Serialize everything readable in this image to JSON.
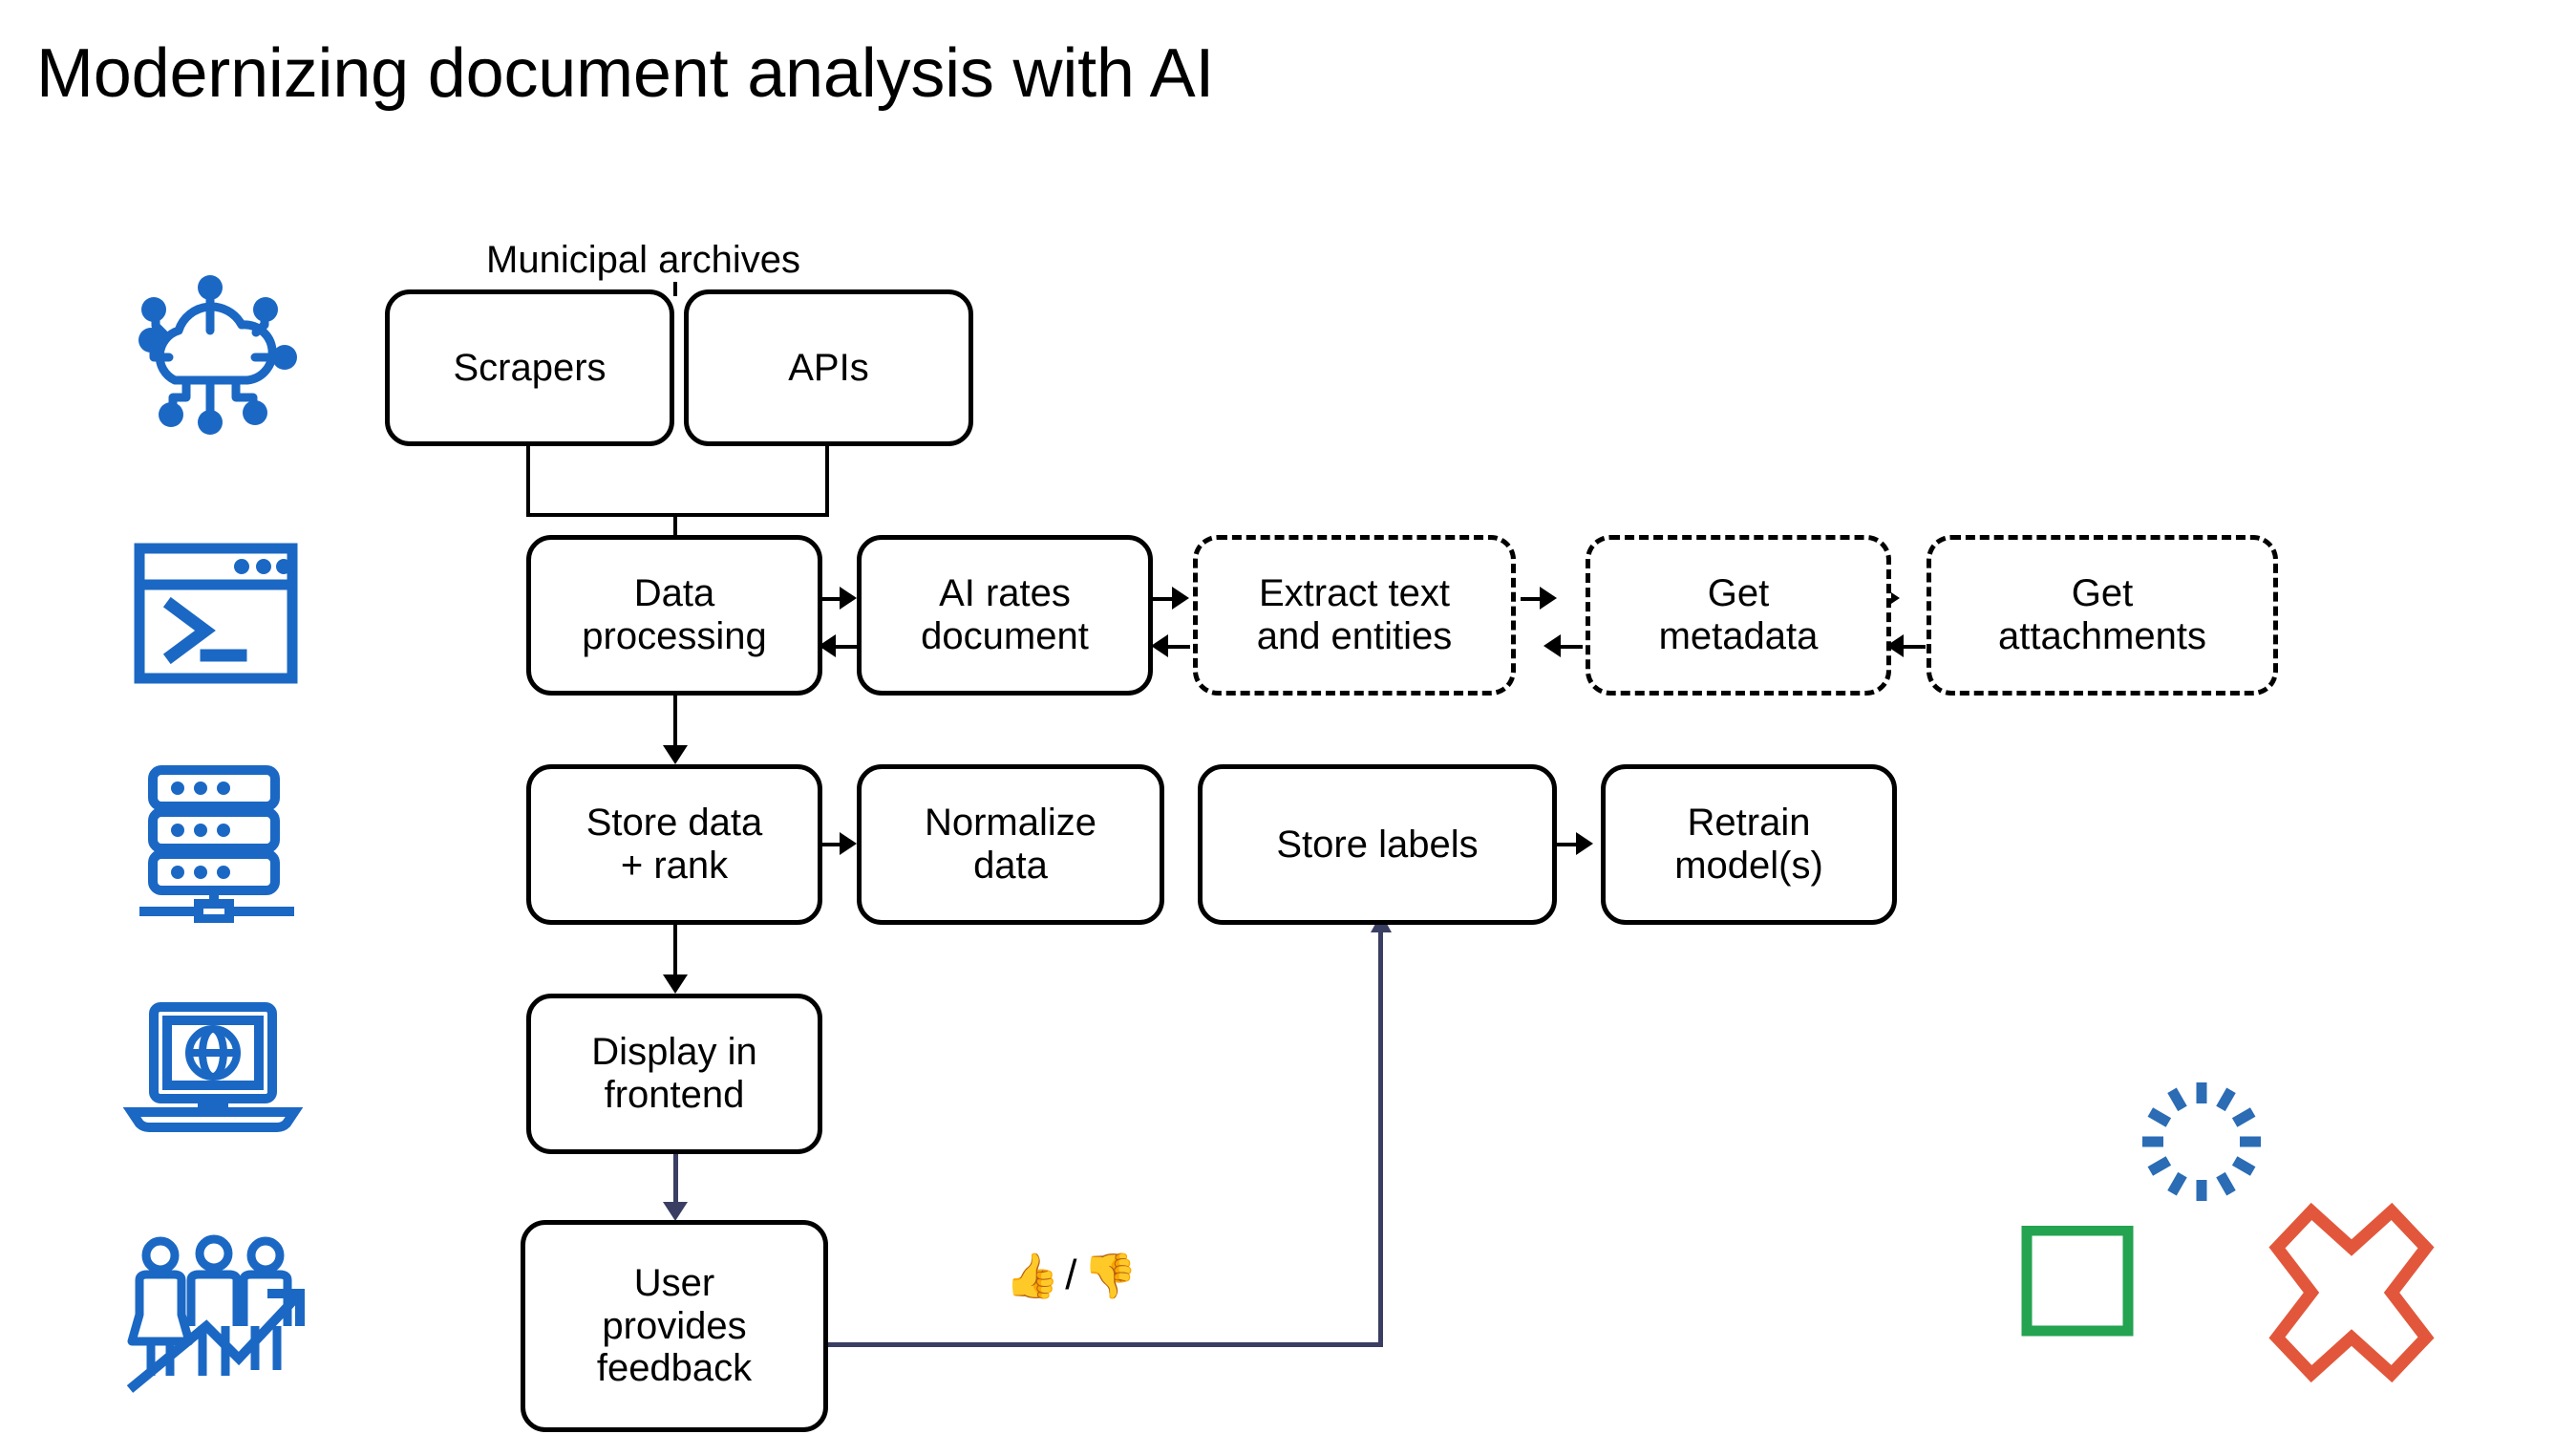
{
  "slide": {
    "title": "Modernizing document analysis with AI",
    "background_color": "#ffffff",
    "accent_blue": "#1b68c4",
    "accent_green": "#24a351",
    "accent_orange": "#e2573b",
    "connector_navy": "#3b3e63"
  },
  "group_caption": {
    "municipal_archives": "Municipal archives"
  },
  "nodes": {
    "scrapers": {
      "label": "Scrapers",
      "style": "solid"
    },
    "apis": {
      "label": "APIs",
      "style": "solid"
    },
    "data_processing": {
      "label_line1": "Data",
      "label_line2": "processing",
      "style": "solid"
    },
    "ai_rates_document": {
      "label_line1": "AI rates",
      "label_line2": "document",
      "style": "solid"
    },
    "extract_text_entities": {
      "label_line1": "Extract text",
      "label_line2": "and entities",
      "style": "dashed"
    },
    "get_metadata": {
      "label_line1": "Get",
      "label_line2": "metadata",
      "style": "dashed"
    },
    "get_attachments": {
      "label_line1": "Get",
      "label_line2": "attachments",
      "style": "dashed"
    },
    "store_data_rank": {
      "label_line1": "Store data",
      "label_line2": "+ rank",
      "style": "solid"
    },
    "normalize_data": {
      "label_line1": "Normalize",
      "label_line2": "data",
      "style": "solid"
    },
    "store_labels": {
      "label": "Store labels",
      "style": "solid"
    },
    "retrain_models": {
      "label_line1": "Retrain",
      "label_line2": "model(s)",
      "style": "solid"
    },
    "display_in_frontend": {
      "label_line1": "Display in",
      "label_line2": "frontend",
      "style": "solid"
    },
    "user_provides_feedback": {
      "label_line1": "User",
      "label_line2": "provides",
      "label_line3": "feedback",
      "style": "solid"
    }
  },
  "feedback": {
    "thumbs_up": "👍",
    "separator": "/",
    "thumbs_down": "👎"
  },
  "rail_icons": [
    {
      "name": "cloud-network-icon",
      "color": "#1b68c4"
    },
    {
      "name": "terminal-console-icon",
      "color": "#1b68c4"
    },
    {
      "name": "server-rack-icon",
      "color": "#1b68c4"
    },
    {
      "name": "laptop-globe-icon",
      "color": "#1b68c4"
    },
    {
      "name": "people-growth-icon",
      "color": "#1b68c4"
    }
  ],
  "decorations": [
    {
      "name": "dashed-circle-shape",
      "color": "#2b6cb5"
    },
    {
      "name": "green-square-shape",
      "color": "#24a351"
    },
    {
      "name": "orange-cross-star-shape",
      "color": "#e2573b"
    }
  ]
}
